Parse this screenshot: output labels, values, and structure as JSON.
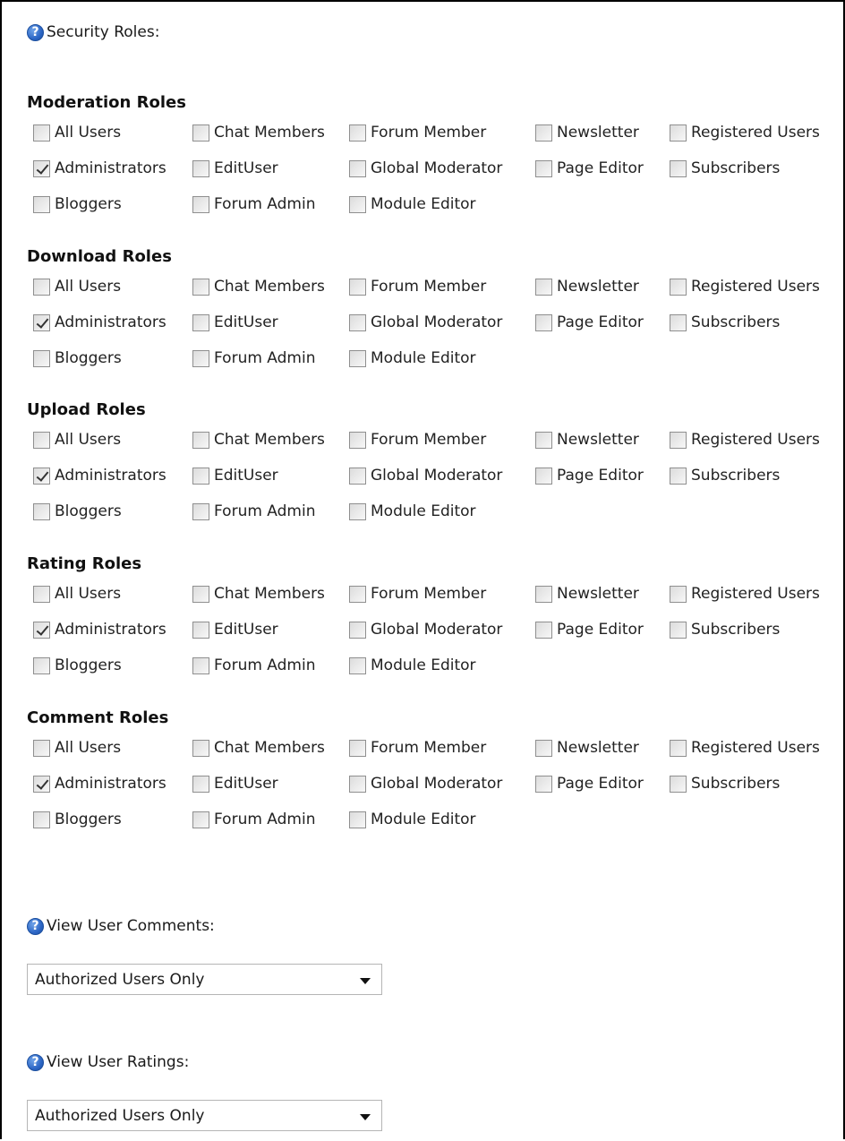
{
  "security_roles_label": "Security Roles:",
  "roles": [
    "All Users",
    "Chat Members",
    "Forum Member",
    "Newsletter",
    "Registered Users",
    "Administrators",
    "EditUser",
    "Global Moderator",
    "Page Editor",
    "Subscribers",
    "Bloggers",
    "Forum Admin",
    "Module Editor"
  ],
  "sections": [
    {
      "title": "Moderation Roles",
      "checked": [
        "Administrators"
      ]
    },
    {
      "title": "Download Roles",
      "checked": [
        "Administrators"
      ]
    },
    {
      "title": "Upload Roles",
      "checked": [
        "Administrators"
      ]
    },
    {
      "title": "Rating Roles",
      "checked": [
        "Administrators"
      ]
    },
    {
      "title": "Comment Roles",
      "checked": [
        "Administrators"
      ]
    }
  ],
  "view_user_comments": {
    "label": "View User Comments:",
    "value": "Authorized Users Only"
  },
  "view_user_ratings": {
    "label": "View User Ratings:",
    "value": "Authorized Users Only"
  }
}
